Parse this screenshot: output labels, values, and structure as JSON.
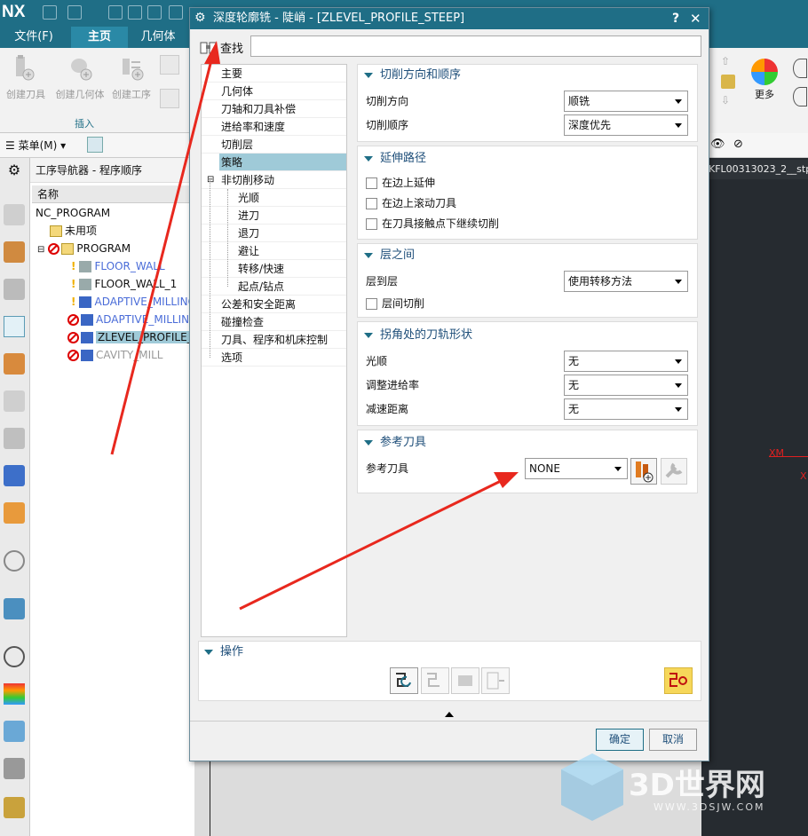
{
  "app": {
    "logo": "NX",
    "menu_tabs": [
      "文件(F)",
      "主页",
      "几何体"
    ],
    "ribbon": {
      "buttons": [
        "创建刀具",
        "创建几何体",
        "创建工序"
      ],
      "group_label": "插入",
      "more_label": "更多"
    },
    "menu_button": "菜单(M)",
    "navigator": {
      "title": "工序导航器 - 程序顺序",
      "column_header": "名称",
      "rows": [
        {
          "name": "NC_PROGRAM"
        },
        {
          "name": "未用项"
        },
        {
          "name": "PROGRAM"
        },
        {
          "name": "FLOOR_WALL"
        },
        {
          "name": "FLOOR_WALL_1"
        },
        {
          "name": "ADAPTIVE_MILLING"
        },
        {
          "name": "ADAPTIVE_MILLING"
        },
        {
          "name": "ZLEVEL_PROFILE_S"
        },
        {
          "name": "CAVITY_MILL"
        }
      ]
    },
    "viewport_title": "KFL00313023_2__stp",
    "viewport_labels": [
      "XM",
      "X"
    ]
  },
  "dialog": {
    "title": "深度轮廓铣 - 陡峭 - [ZLEVEL_PROFILE_STEEP]",
    "help": "?",
    "close": "✕",
    "find_label": "查找",
    "find_value": "",
    "tree": [
      "主要",
      "几何体",
      "刀轴和刀具补偿",
      "进给率和速度",
      "切削层",
      "策略",
      "非切削移动",
      "光顺",
      "进刀",
      "退刀",
      "避让",
      "转移/快速",
      "起点/钻点",
      "公差和安全距离",
      "碰撞检查",
      "刀具、程序和机床控制",
      "选项"
    ],
    "selected_tree_item": "策略",
    "sections": {
      "cut_direction_order": {
        "title": "切削方向和顺序",
        "cut_direction_label": "切削方向",
        "cut_direction_value": "顺铣",
        "cut_order_label": "切削顺序",
        "cut_order_value": "深度优先"
      },
      "extend_path": {
        "title": "延伸路径",
        "opt1": "在边上延伸",
        "opt2": "在边上滚动刀具",
        "opt3": "在刀具接触点下继续切削"
      },
      "between_levels": {
        "title": "层之间",
        "level_to_level_label": "层到层",
        "level_to_level_value": "使用转移方法",
        "cut_between_levels": "层间切削"
      },
      "corner_path": {
        "title": "拐角处的刀轨形状",
        "smoothing_label": "光顺",
        "smoothing_value": "无",
        "adjust_feed_label": "调整进给率",
        "adjust_feed_value": "无",
        "slowdown_label": "减速距离",
        "slowdown_value": "无"
      },
      "reference_tool": {
        "title": "参考刀具",
        "label": "参考刀具",
        "value": "NONE"
      }
    },
    "operations": {
      "title": "操作"
    },
    "ok": "确定",
    "cancel": "取消"
  },
  "watermark": {
    "brand": "3D世界网",
    "url": "WWW.3DSJW.COM"
  },
  "colors": {
    "accent": "#1f6e86",
    "annotation_arrow": "#e8281e"
  }
}
